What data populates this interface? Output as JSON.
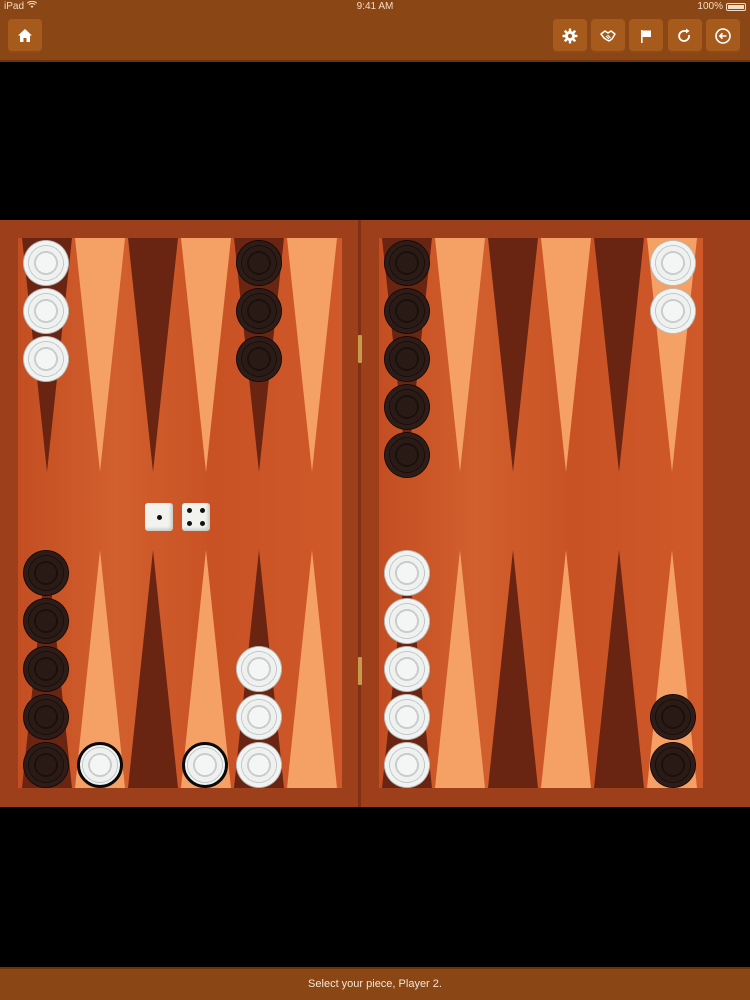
{
  "status_bar": {
    "device": "iPad",
    "time": "9:41 AM",
    "battery": "100%"
  },
  "toolbar": {
    "home_icon": "home-icon",
    "buttons": [
      {
        "icon": "gear-icon"
      },
      {
        "icon": "handshake-icon"
      },
      {
        "icon": "flag-icon"
      },
      {
        "icon": "redo-icon"
      },
      {
        "icon": "exit-icon"
      }
    ]
  },
  "colors": {
    "toolbar": "#8a4614",
    "frame": "#9d3f1b",
    "light_point": "#f5a064",
    "dark_point": "#6a2412",
    "white_checker": "#eef1ef",
    "black_checker": "#2a1a15"
  },
  "dice": [
    1,
    4
  ],
  "checkers": {
    "top_left_point_1_white": 3,
    "top_left_point_5_black": 3,
    "top_right_point_1_black": 5,
    "top_right_point_6_white": 2,
    "bottom_left_point_1_black": 5,
    "bottom_left_point_2_white_selected": 1,
    "bottom_left_point_4_white_selected": 1,
    "bottom_left_point_5_white": 3,
    "bottom_right_point_1_white": 5,
    "bottom_right_point_6_black": 2
  },
  "message": "Select your piece, Player 2."
}
